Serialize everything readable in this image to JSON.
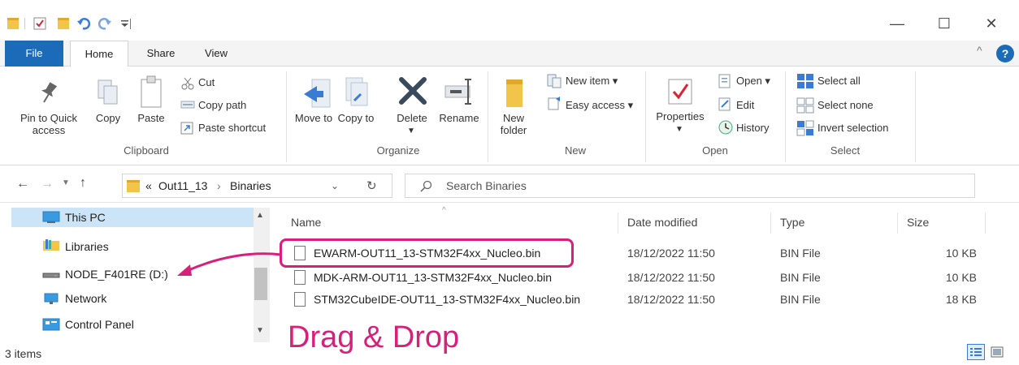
{
  "window": {
    "minimize": "—",
    "maximize": "☐",
    "close": "✕",
    "collapse": "^",
    "help": "?"
  },
  "tabs": {
    "file": "File",
    "home": "Home",
    "share": "Share",
    "view": "View"
  },
  "ribbon": {
    "clipboard": {
      "pin": "Pin to Quick access",
      "copy": "Copy",
      "paste": "Paste",
      "cut": "Cut",
      "copy_path": "Copy path",
      "paste_shortcut": "Paste shortcut",
      "label": "Clipboard"
    },
    "organize": {
      "move_to": "Move to",
      "copy_to": "Copy to",
      "delete": "Delete",
      "rename": "Rename",
      "label": "Organize"
    },
    "new": {
      "new_folder": "New folder",
      "new_item": "New item ▾",
      "easy_access": "Easy access ▾",
      "label": "New"
    },
    "open": {
      "properties": "Properties",
      "open": "Open ▾",
      "edit": "Edit",
      "history": "History",
      "label": "Open"
    },
    "select": {
      "select_all": "Select all",
      "select_none": "Select none",
      "invert_selection": "Invert selection",
      "label": "Select"
    }
  },
  "address": {
    "prefix": "«",
    "crumb1": "Out11_13",
    "sep": "›",
    "crumb2": "Binaries",
    "search_placeholder": "Search Binaries"
  },
  "nav": {
    "items": [
      "This PC",
      "Libraries",
      "NODE_F401RE (D:)",
      "Network",
      "Control Panel"
    ]
  },
  "columns": {
    "name": "Name",
    "date": "Date modified",
    "type": "Type",
    "size": "Size"
  },
  "files": [
    {
      "name": "EWARM-OUT11_13-STM32F4xx_Nucleo.bin",
      "date": "18/12/2022 11:50",
      "type": "BIN File",
      "size": "10 KB"
    },
    {
      "name": "MDK-ARM-OUT11_13-STM32F4xx_Nucleo.bin",
      "date": "18/12/2022 11:50",
      "type": "BIN File",
      "size": "10 KB"
    },
    {
      "name": "STM32CubeIDE-OUT11_13-STM32F4xx_Nucleo.bin",
      "date": "18/12/2022 11:50",
      "type": "BIN File",
      "size": "18 KB"
    }
  ],
  "annotation": {
    "text": "Drag & Drop",
    "color": "#d6207a"
  },
  "status": {
    "items": "3 items"
  },
  "colors": {
    "accent": "#1b6bb8",
    "highlight": "#d6207a"
  }
}
